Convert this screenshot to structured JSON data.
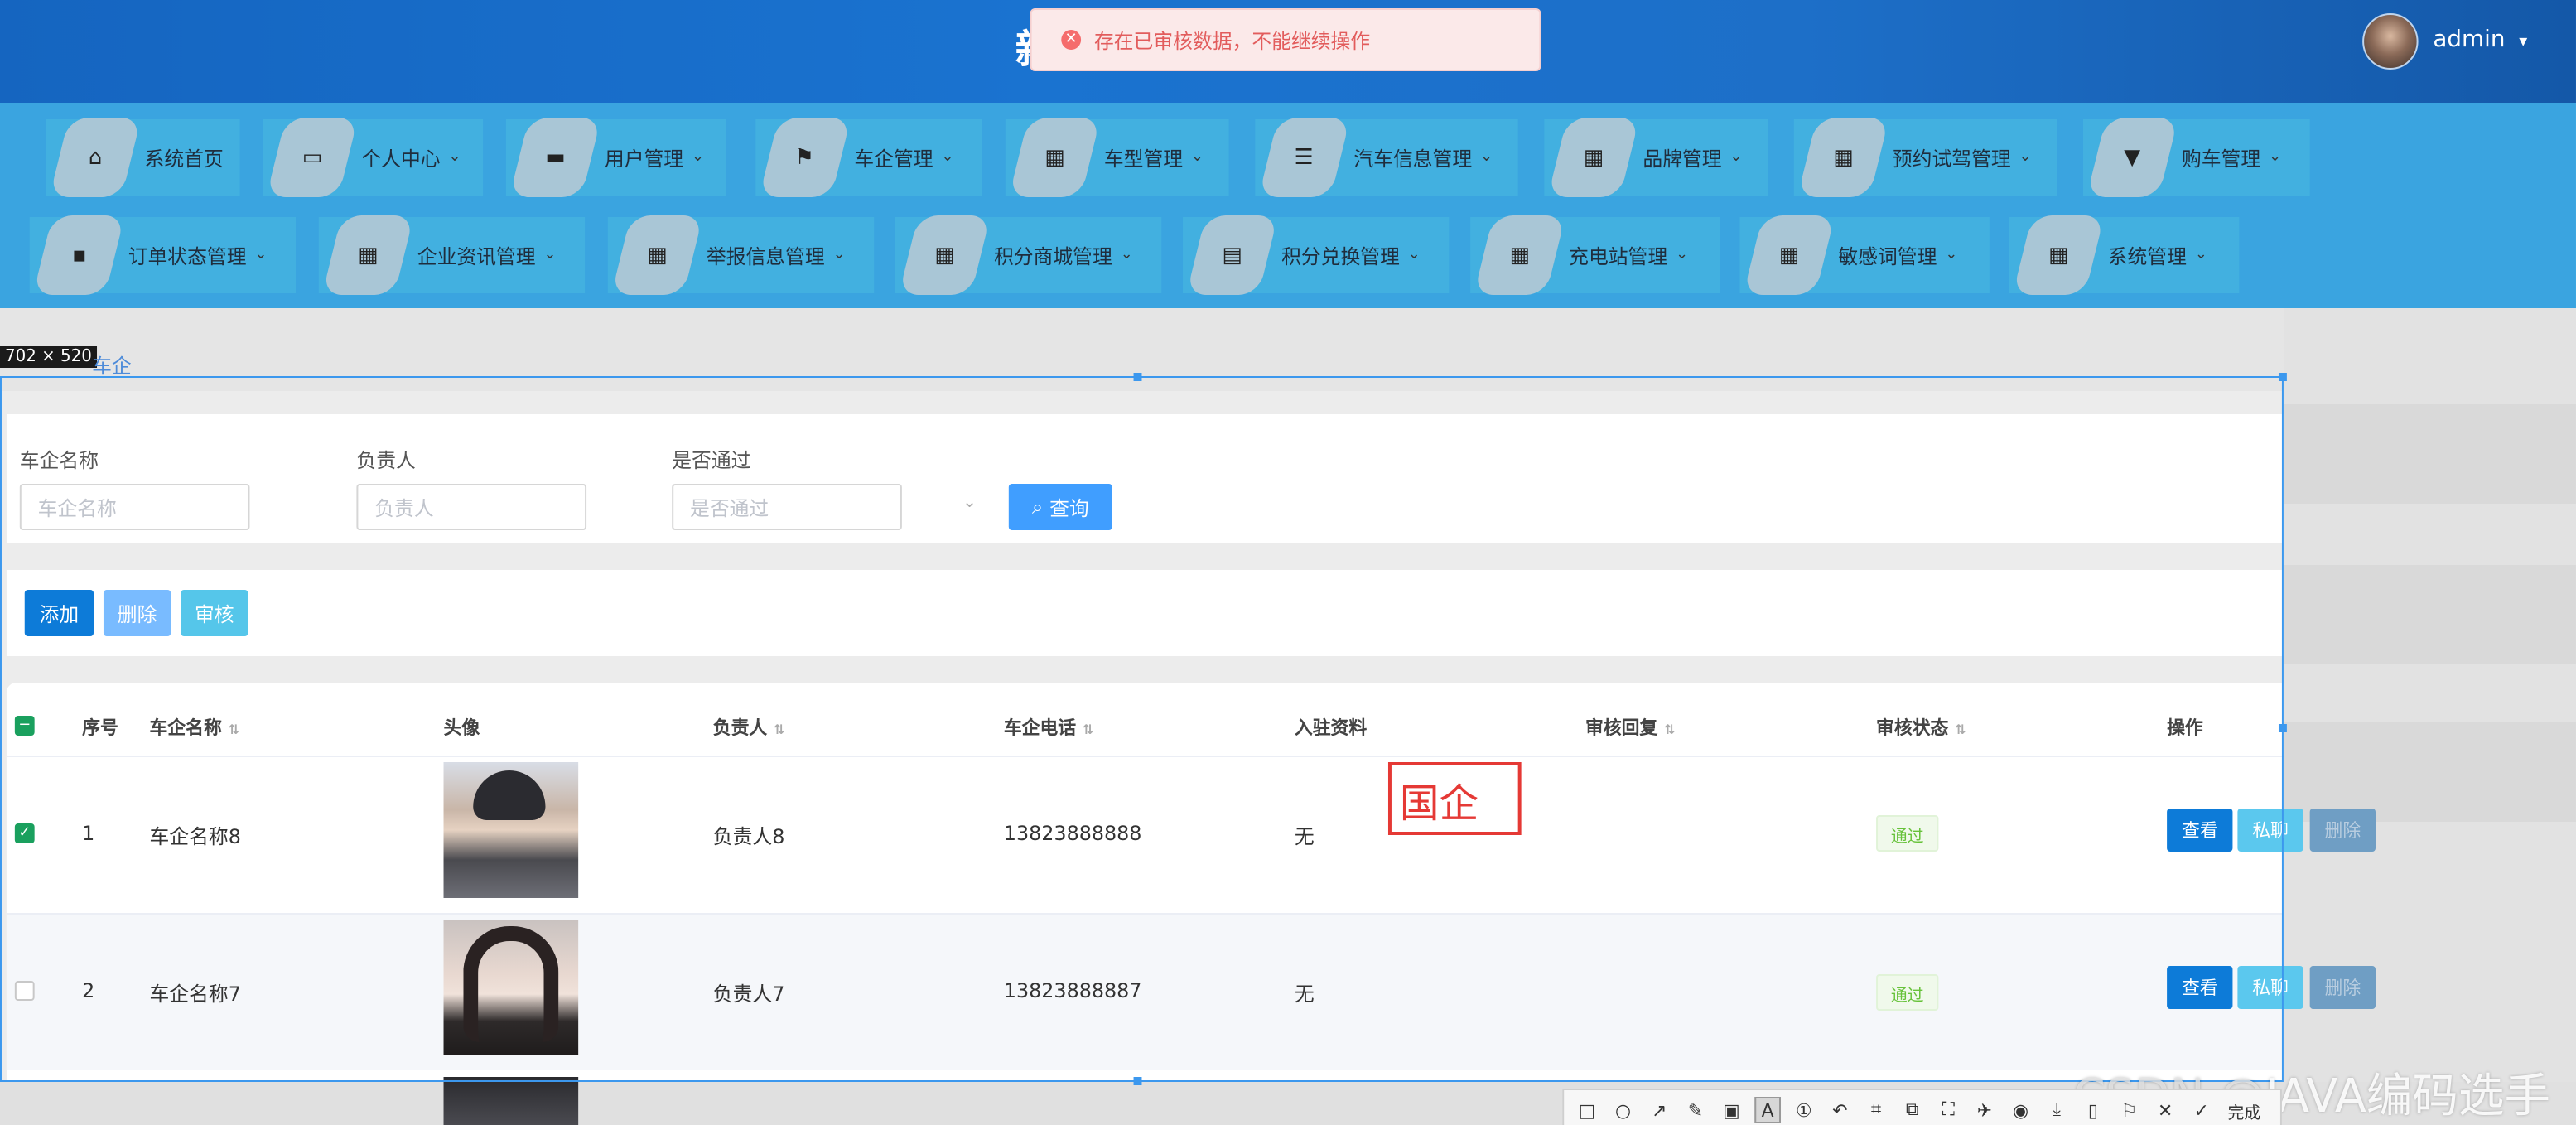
{
  "header": {
    "title_fragment": "新",
    "alert_text": "存在已审核数据，不能继续操作",
    "user_name": "admin"
  },
  "nav": {
    "row1": [
      {
        "label": "系统首页",
        "icon": "⌂",
        "chevron": false
      },
      {
        "label": "个人中心",
        "icon": "▭",
        "chevron": true
      },
      {
        "label": "用户管理",
        "icon": "▬",
        "chevron": true
      },
      {
        "label": "车企管理",
        "icon": "⚑",
        "chevron": true
      },
      {
        "label": "车型管理",
        "icon": "▦",
        "chevron": true
      },
      {
        "label": "汽车信息管理",
        "icon": "☰",
        "chevron": true
      },
      {
        "label": "品牌管理",
        "icon": "▦",
        "chevron": true
      },
      {
        "label": "预约试驾管理",
        "icon": "▦",
        "chevron": true
      },
      {
        "label": "购车管理",
        "icon": "▼",
        "chevron": true
      }
    ],
    "row2": [
      {
        "label": "订单状态管理",
        "icon": "▪",
        "chevron": true
      },
      {
        "label": "企业资讯管理",
        "icon": "▦",
        "chevron": true
      },
      {
        "label": "举报信息管理",
        "icon": "▦",
        "chevron": true
      },
      {
        "label": "积分商城管理",
        "icon": "▦",
        "chevron": true
      },
      {
        "label": "积分兑换管理",
        "icon": "▤",
        "chevron": true
      },
      {
        "label": "充电站管理",
        "icon": "▦",
        "chevron": true
      },
      {
        "label": "敏感词管理",
        "icon": "▦",
        "chevron": true
      },
      {
        "label": "系统管理",
        "icon": "▦",
        "chevron": true
      }
    ]
  },
  "screenshot_size_label": "702 × 520",
  "breadcrumb": "车企",
  "search": {
    "name_label": "车企名称",
    "name_placeholder": "车企名称",
    "person_label": "负责人",
    "person_placeholder": "负责人",
    "pass_label": "是否通过",
    "pass_placeholder": "是否通过",
    "query_label": "查询"
  },
  "actions": {
    "add": "添加",
    "delete": "删除",
    "audit": "审核"
  },
  "table": {
    "headers": {
      "index": "序号",
      "name": "车企名称",
      "avatar": "头像",
      "person": "负责人",
      "phone": "车企电话",
      "docs": "入驻资料",
      "reply": "审核回复",
      "status": "审核状态",
      "ops": "操作"
    },
    "rows": [
      {
        "index": "1",
        "name": "车企名称8",
        "person": "负责人8",
        "phone": "13823888888",
        "docs": "无",
        "reply": "",
        "status": "通过",
        "checked": true
      },
      {
        "index": "2",
        "name": "车企名称7",
        "person": "负责人7",
        "phone": "13823888887",
        "docs": "无",
        "reply": "",
        "status": "通过",
        "checked": false
      }
    ],
    "op_view": "查看",
    "op_private": "私聊",
    "op_delete": "删除"
  },
  "annotation_text": "国企",
  "toolbar": {
    "done_label": "完成"
  },
  "watermark": {
    "prefix": "CSDN @",
    "name": "JAVA编码选手"
  },
  "colors": {
    "header": "#1565c0",
    "nav": "#3aa4e0",
    "primary": "#409eff",
    "add_button": "#0d7bd8",
    "delete_button": "#79bbff",
    "audit_button": "#55c6ea",
    "danger_alert": "#f56c6c",
    "success_badge": "#67c23a"
  }
}
